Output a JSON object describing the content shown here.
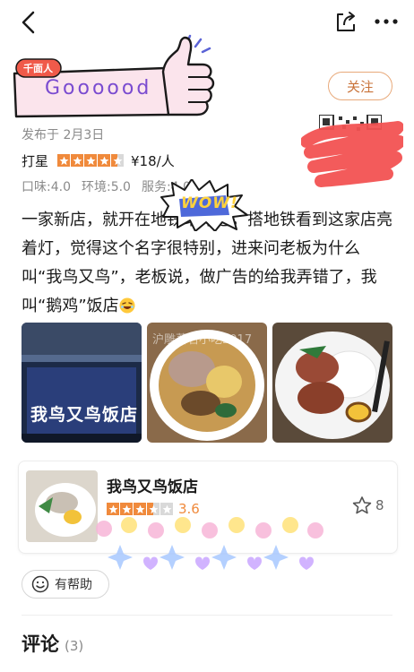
{
  "header": {
    "back_icon": "chevron-left-icon",
    "share_icon": "share-icon",
    "more_icon": "more-dots-icon"
  },
  "author_banner": {
    "badge": "千面人",
    "text": "Goooood"
  },
  "follow": {
    "label": "关注"
  },
  "post": {
    "published": "发布于 2月3日",
    "rating_label": "打星",
    "rating_stars": 4.5,
    "price": "¥18/人",
    "sub_scores": [
      "口味:4.0",
      "环境:5.0",
      "服务:4.0"
    ],
    "sticker_text": "WOW!",
    "content": "一家新店，就开在地铁站旁边，搭地铁看到这家店亮着灯，觉得这个名字很特别，进来问老板为什么叫“我鸟又鸟”，老板说，做广告的给我弄错了，我叫“鹅鸡”饭店",
    "photo_sign": "我鸟又鸟饭店",
    "watermark": "沪雕著名小吃2017"
  },
  "shop": {
    "name": "我鸟又鸟饭店",
    "stars": 3.5,
    "score": "3.6",
    "fav_count": "8"
  },
  "helpful": {
    "label": "有帮助"
  },
  "comments": {
    "title": "评论",
    "count": "(3)"
  },
  "colors": {
    "accent": "#f08a3c",
    "follow_border": "#e8a97a",
    "banner_bg": "#fbe4ec",
    "banner_text": "#7a4bd0"
  }
}
